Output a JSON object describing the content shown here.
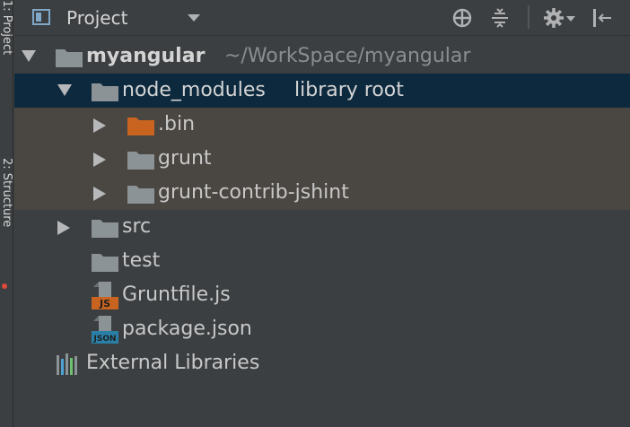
{
  "panel": {
    "title": "Project",
    "toolbar_icons": [
      "crosshair-icon",
      "collapse-all-icon",
      "gear-icon",
      "hide-panel-icon"
    ]
  },
  "side_tabs": {
    "tab1": "1: Project",
    "tab2": "2: Structure"
  },
  "tree": {
    "root": {
      "name": "myangular",
      "path": "~/WorkSpace/myangular"
    },
    "node_modules": {
      "name": "node_modules",
      "tag": "library root"
    },
    "bin": {
      "name": ".bin"
    },
    "grunt": {
      "name": "grunt"
    },
    "grunt_contrib": {
      "name": "grunt-contrib-jshint"
    },
    "src": {
      "name": "src"
    },
    "test": {
      "name": "test"
    },
    "gruntfile": {
      "name": "Gruntfile.js",
      "badge": "JS"
    },
    "package": {
      "name": "package.json",
      "badge": "JSON"
    },
    "external": {
      "name": "External Libraries"
    }
  },
  "colors": {
    "background": "#3c3f41",
    "selection": "#0d293e",
    "library_zone": "#4a4641",
    "folder": "#8c9397",
    "excluded_folder": "#c8641f",
    "js_badge": "#c8641f",
    "json_badge": "#2a7fa6"
  }
}
